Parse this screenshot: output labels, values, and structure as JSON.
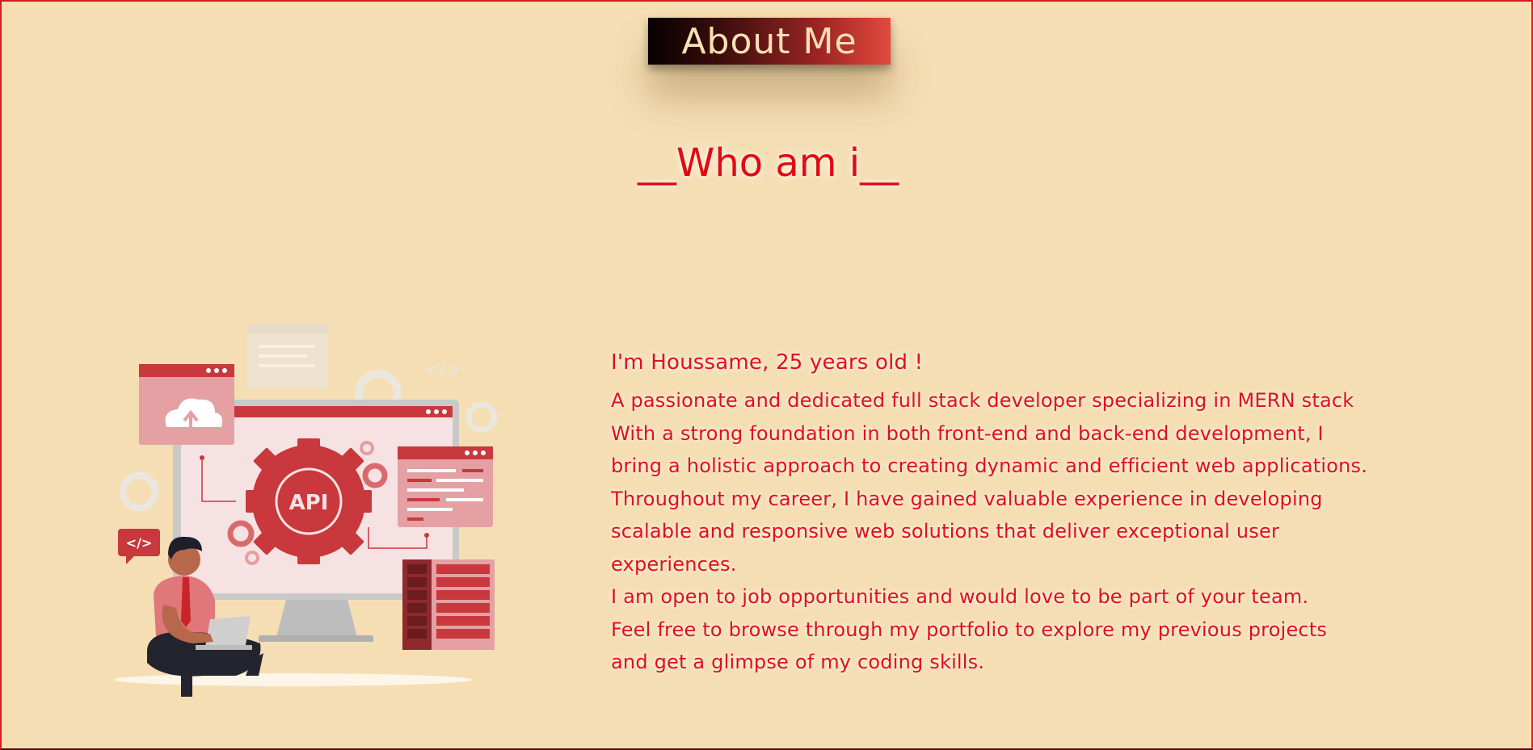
{
  "header": {
    "badge_label": "About Me",
    "section_title": "__Who am i__"
  },
  "illustration": {
    "api_label": "API",
    "code_badge": "</>",
    "code_badge_faded": "</>"
  },
  "about": {
    "intro": "I'm Houssame, 25 years old !",
    "lines": [
      "A passionate and dedicated full stack developer specializing in MERN stack",
      "With a strong foundation in both front-end and back-end development, I",
      "bring a holistic approach to creating dynamic and efficient web applications.",
      "Throughout my career, I have gained valuable experience in developing",
      "scalable and responsive web solutions that deliver exceptional user",
      "experiences.",
      "I am open to job opportunities and would love to be part of your team.",
      "Feel free to browse through my portfolio to explore my previous projects",
      "and get a glimpse of my coding skills."
    ]
  },
  "colors": {
    "background": "#f5deb3",
    "accent_red": "#e00b12",
    "illustration_red": "#c8383c"
  }
}
